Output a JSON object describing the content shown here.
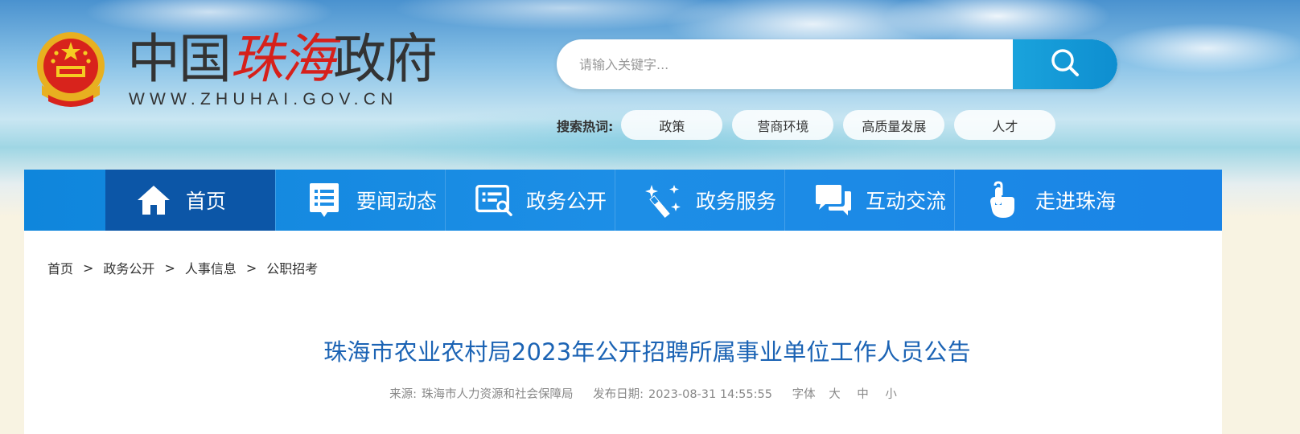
{
  "header": {
    "logo_prefix": "中国",
    "logo_city": "珠海",
    "logo_suffix": "政府",
    "logo_url": "WWW.ZHUHAI.GOV.CN"
  },
  "search": {
    "placeholder": "请输入关键字..."
  },
  "hot_search": {
    "label": "搜索热词:",
    "tags": [
      "政策",
      "营商环境",
      "高质量发展",
      "人才"
    ]
  },
  "nav": {
    "items": [
      {
        "label": "首页",
        "icon": "home-icon"
      },
      {
        "label": "要闻动态",
        "icon": "news-list-icon"
      },
      {
        "label": "政务公开",
        "icon": "document-search-icon"
      },
      {
        "label": "政务服务",
        "icon": "magic-wand-icon"
      },
      {
        "label": "互动交流",
        "icon": "chat-bubbles-icon"
      },
      {
        "label": "走进珠海",
        "icon": "hand-pointer-icon"
      }
    ],
    "active_index": 0
  },
  "breadcrumb": [
    "首页",
    "政务公开",
    "人事信息",
    "公职招考"
  ],
  "breadcrumb_sep": ">",
  "article": {
    "title": "珠海市农业农村局2023年公开招聘所属事业单位工作人员公告",
    "source_label": "来源:",
    "source": "珠海市人力资源和社会保障局",
    "date_label": "发布日期:",
    "date": "2023-08-31 14:55:55",
    "font_label": "字体",
    "font_sizes": [
      "大",
      "中",
      "小"
    ]
  },
  "colors": {
    "nav_bg": "#1d8ee6",
    "nav_active": "#0c56a7",
    "title": "#1b63b4",
    "logo_red": "#d6201b"
  }
}
